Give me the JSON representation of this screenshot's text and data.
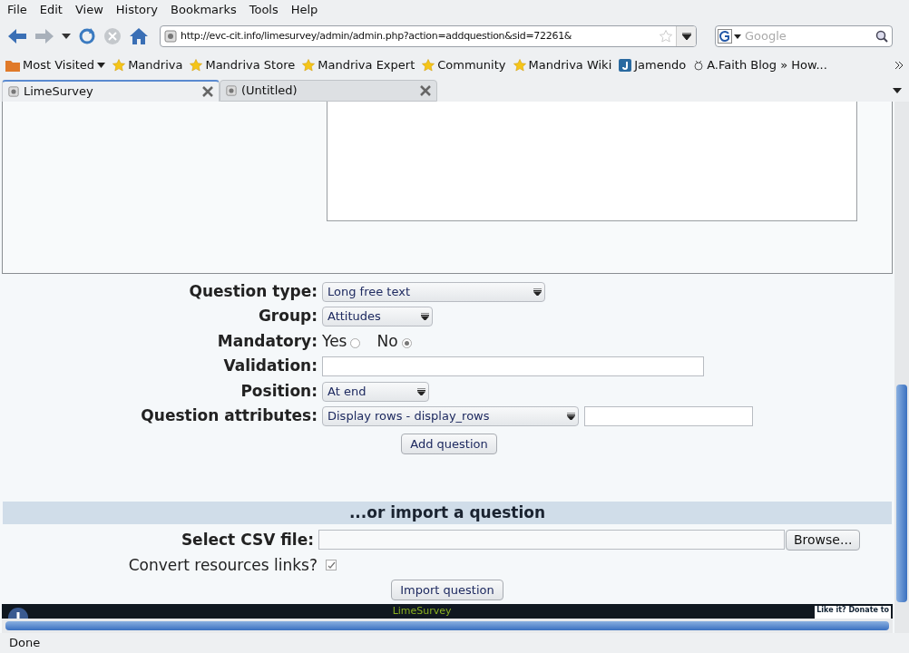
{
  "menu": [
    "File",
    "Edit",
    "View",
    "History",
    "Bookmarks",
    "Tools",
    "Help"
  ],
  "address": {
    "value": "http://evc-cit.info/limesurvey/admin/admin.php?action=addquestion&sid=72261&"
  },
  "search": {
    "placeholder": "Google"
  },
  "bookmarks": [
    {
      "label": "Most Visited",
      "kind": "folder"
    },
    {
      "label": "Mandriva",
      "kind": "star"
    },
    {
      "label": "Mandriva Store",
      "kind": "star"
    },
    {
      "label": "Mandriva Expert",
      "kind": "star"
    },
    {
      "label": "Community",
      "kind": "star"
    },
    {
      "label": "Mandriva Wiki",
      "kind": "star"
    },
    {
      "label": "Jamendo",
      "kind": "logo"
    },
    {
      "label": "A.Faith Blog » How...",
      "kind": "face"
    }
  ],
  "tabs": [
    {
      "label": "LimeSurvey",
      "selected": true
    },
    {
      "label": "(Untitled)",
      "selected": false
    }
  ],
  "form": [
    {
      "label": "Question type:",
      "kind": "select",
      "value": "Long free text"
    },
    {
      "label": "Group:",
      "kind": "select",
      "value": "Attitudes"
    },
    {
      "label": "Mandatory:",
      "kind": "radio",
      "options": [
        {
          "label": "Yes",
          "selected": false
        },
        {
          "label": "No",
          "selected": true
        }
      ]
    },
    {
      "label": "Validation:",
      "kind": "text"
    },
    {
      "label": "Position:",
      "kind": "select",
      "value": "At end"
    },
    {
      "label": "Question attributes:",
      "kind": "select-text",
      "value": "Display rows - display_rows"
    }
  ],
  "add_button": "Add question",
  "import": {
    "heading": "...or import a question",
    "file_label": "Select CSV file:",
    "browse": "Browse...",
    "convert_label": "Convert resources links?",
    "convert_checked": true,
    "button": "Import question"
  },
  "footer": {
    "title": "LimeSurvey",
    "donate": "Like it? Donate to"
  },
  "status": "Done"
}
